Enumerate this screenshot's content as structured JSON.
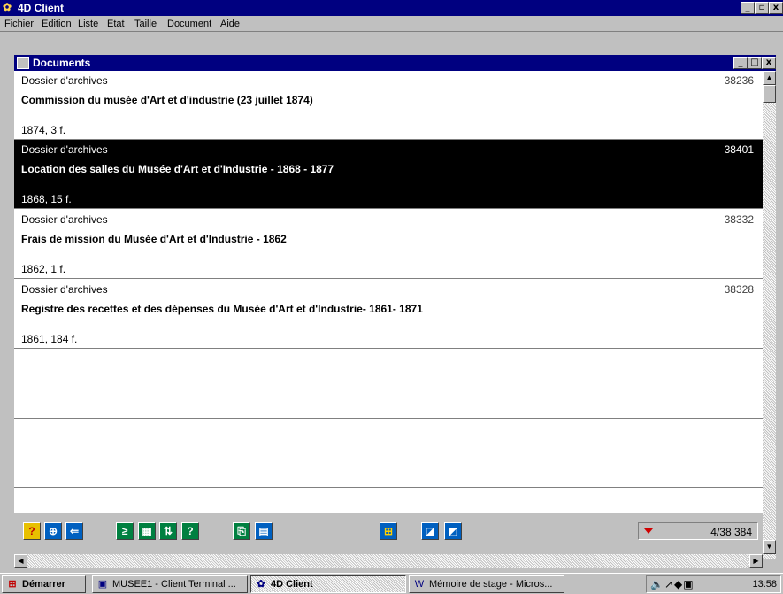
{
  "app": {
    "title": "4D Client",
    "caption_buttons": [
      "_",
      "▫",
      "x"
    ]
  },
  "menu": [
    "Fichier",
    "Edition",
    "Liste",
    "Etat",
    "Taille",
    "Document",
    "Aide"
  ],
  "document_window": {
    "title": "Documents",
    "caption_buttons": [
      "_",
      "□",
      "x"
    ]
  },
  "records": [
    {
      "type": "Dossier d'archives",
      "number": "38236",
      "title": "Commission du musée d'Art et d'industrie (23 juillet 1874)",
      "meta": "1874, 3 f.",
      "selected": false
    },
    {
      "type": "Dossier d'archives",
      "number": "38401",
      "title": "Location des salles du Musée d'Art et d'Industrie - 1868 - 1877",
      "meta": "1868, 15 f.",
      "selected": true
    },
    {
      "type": "Dossier d'archives",
      "number": "38332",
      "title": "Frais de mission du Musée d'Art et d'Industrie - 1862",
      "meta": "1862, 1 f.",
      "selected": false
    },
    {
      "type": "Dossier d'archives",
      "number": "38328",
      "title": "Registre des recettes et des dépenses du Musée d'Art et d'Industrie- 1861- 1871",
      "meta": "1861, 184 f.",
      "selected": false
    }
  ],
  "toolbar": {
    "buttons": [
      {
        "name": "help-icon",
        "glyph": "?",
        "color": "#c00000"
      },
      {
        "name": "lifebuoy-icon",
        "glyph": "⊕",
        "color": "#c06000"
      },
      {
        "name": "back-icon",
        "glyph": "⇐",
        "color": "#0050a0"
      },
      {
        "name": "next-record-icon",
        "glyph": "≥",
        "color": "#008040"
      },
      {
        "name": "list-view-icon",
        "glyph": "▦",
        "color": "#008040"
      },
      {
        "name": "sort-icon",
        "glyph": "⇅",
        "color": "#008040"
      },
      {
        "name": "query-icon",
        "glyph": "?",
        "color": "#008040"
      },
      {
        "name": "export-icon",
        "glyph": "⎘",
        "color": "#008040"
      },
      {
        "name": "save-icon",
        "glyph": "▤",
        "color": "#0050a0"
      },
      {
        "name": "grid-icon",
        "glyph": "⊞",
        "color": "#0050a0"
      },
      {
        "name": "open-icon",
        "glyph": "◪",
        "color": "#0050a0"
      },
      {
        "name": "edit-icon",
        "glyph": "◩",
        "color": "#0050a0"
      }
    ],
    "counter": "4/38 384"
  },
  "taskbar": {
    "start": "Démarrer",
    "tasks": [
      "MUSEE1 - Client Terminal ...",
      "4D Client",
      "Mémoire de stage - Micros..."
    ],
    "clock": "13:58"
  }
}
